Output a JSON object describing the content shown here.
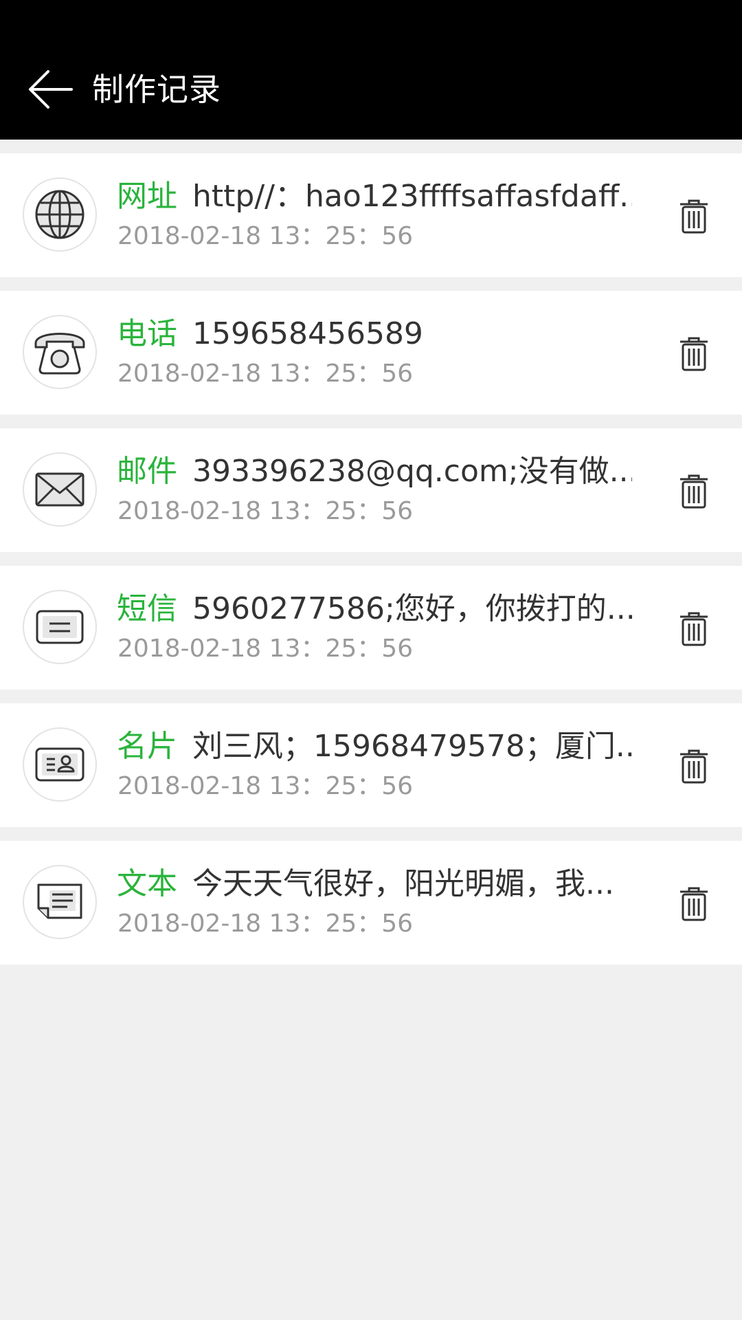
{
  "header": {
    "title": "制作记录",
    "back_icon": "arrow-left-icon",
    "background": "#000000"
  },
  "accent_color": "#2ab43c",
  "records": [
    {
      "type": "网址",
      "icon": "globe-icon",
      "content": "http//：hao123ffffsaffasfdaff...",
      "time": "2018-02-18 13：25：56"
    },
    {
      "type": "电话",
      "icon": "telephone-icon",
      "content": "159658456589",
      "time": "2018-02-18 13：25：56"
    },
    {
      "type": "邮件",
      "icon": "envelope-icon",
      "content": "393396238@qq.com;没有做...",
      "time": "2018-02-18 13：25：56"
    },
    {
      "type": "短信",
      "icon": "message-icon",
      "content": "5960277586;您好，你拨打的...",
      "time": "2018-02-18 13：25：56"
    },
    {
      "type": "名片",
      "icon": "business-card-icon",
      "content": "刘三风；15968479578；厦门...",
      "time": "2018-02-18 13：25：56"
    },
    {
      "type": "文本",
      "icon": "document-icon",
      "content": "今天天气很好，阳光明媚，我...",
      "time": "2018-02-18 13：25：56"
    }
  ],
  "delete_icon": "trash-icon"
}
